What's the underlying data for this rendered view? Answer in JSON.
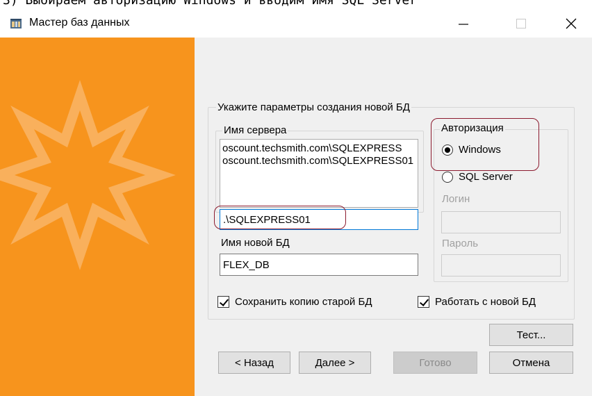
{
  "caption": "3) Выбираем авторизацию Windows и вводим имя SQL Server",
  "window": {
    "title": "Мастер баз данных"
  },
  "params_group": {
    "legend": "Укажите параметры создания новой БД"
  },
  "server_group": {
    "legend": "Имя сервера",
    "list_items": [
      "oscount.techsmith.com\\SQLEXPRESS",
      "oscount.techsmith.com\\SQLEXPRESS01"
    ],
    "server_value": ".\\SQLEXPRESS01"
  },
  "new_db": {
    "label": "Имя новой БД",
    "value": "FLEX_DB"
  },
  "auth_group": {
    "legend": "Авторизация",
    "windows_label": "Windows",
    "sqlserver_label": "SQL Server",
    "login_label": "Логин",
    "password_label": "Пароль",
    "selected": "windows"
  },
  "options": {
    "keep_copy_label": "Сохранить копию старой БД",
    "keep_copy_checked": true,
    "work_new_label": "Работать с новой БД",
    "work_new_checked": true
  },
  "buttons": {
    "test": "Тест...",
    "back": "< Назад",
    "next": "Далее >",
    "finish": "Готово",
    "cancel": "Отмена"
  },
  "colors": {
    "sidebar": "#f7941d",
    "highlight": "#8b1a2e",
    "focus": "#0078d7"
  }
}
